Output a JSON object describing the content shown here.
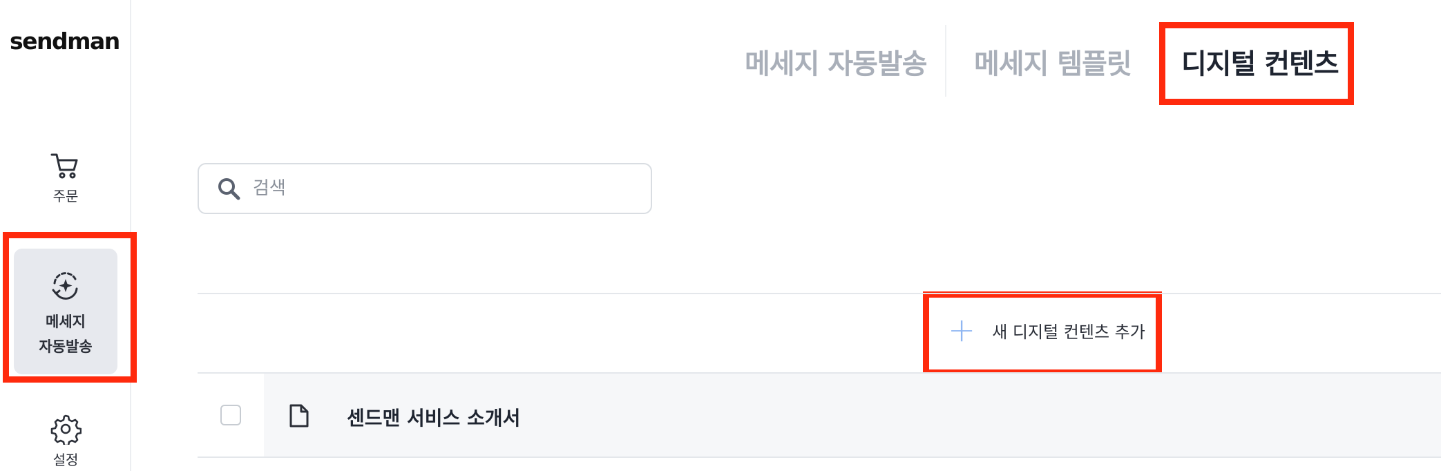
{
  "app": {
    "logo": "sendman"
  },
  "sidebar": {
    "items": [
      {
        "label": "주문",
        "icon": "cart-icon"
      },
      {
        "label_line1": "메세지",
        "label_line2": "자동발송",
        "icon": "auto-send-icon",
        "active": true
      },
      {
        "label": "설정",
        "icon": "gear-icon"
      }
    ]
  },
  "tabs": [
    {
      "label": "메세지 자동발송",
      "active": false
    },
    {
      "label": "메세지 템플릿",
      "active": false
    },
    {
      "label": "디지털 컨텐츠",
      "active": true
    }
  ],
  "search": {
    "placeholder": "검색",
    "value": ""
  },
  "actions": {
    "add_label": "새 디지털 컨텐츠 추가"
  },
  "rows": [
    {
      "title": "센드맨 서비스 소개서",
      "checked": false,
      "icon": "document-icon"
    }
  ],
  "colors": {
    "highlight": "#ff2a0d",
    "active_nav_bg": "#e7e9ee",
    "inactive_tab": "#a9afb9",
    "plus_accent": "#8fb6f2"
  }
}
